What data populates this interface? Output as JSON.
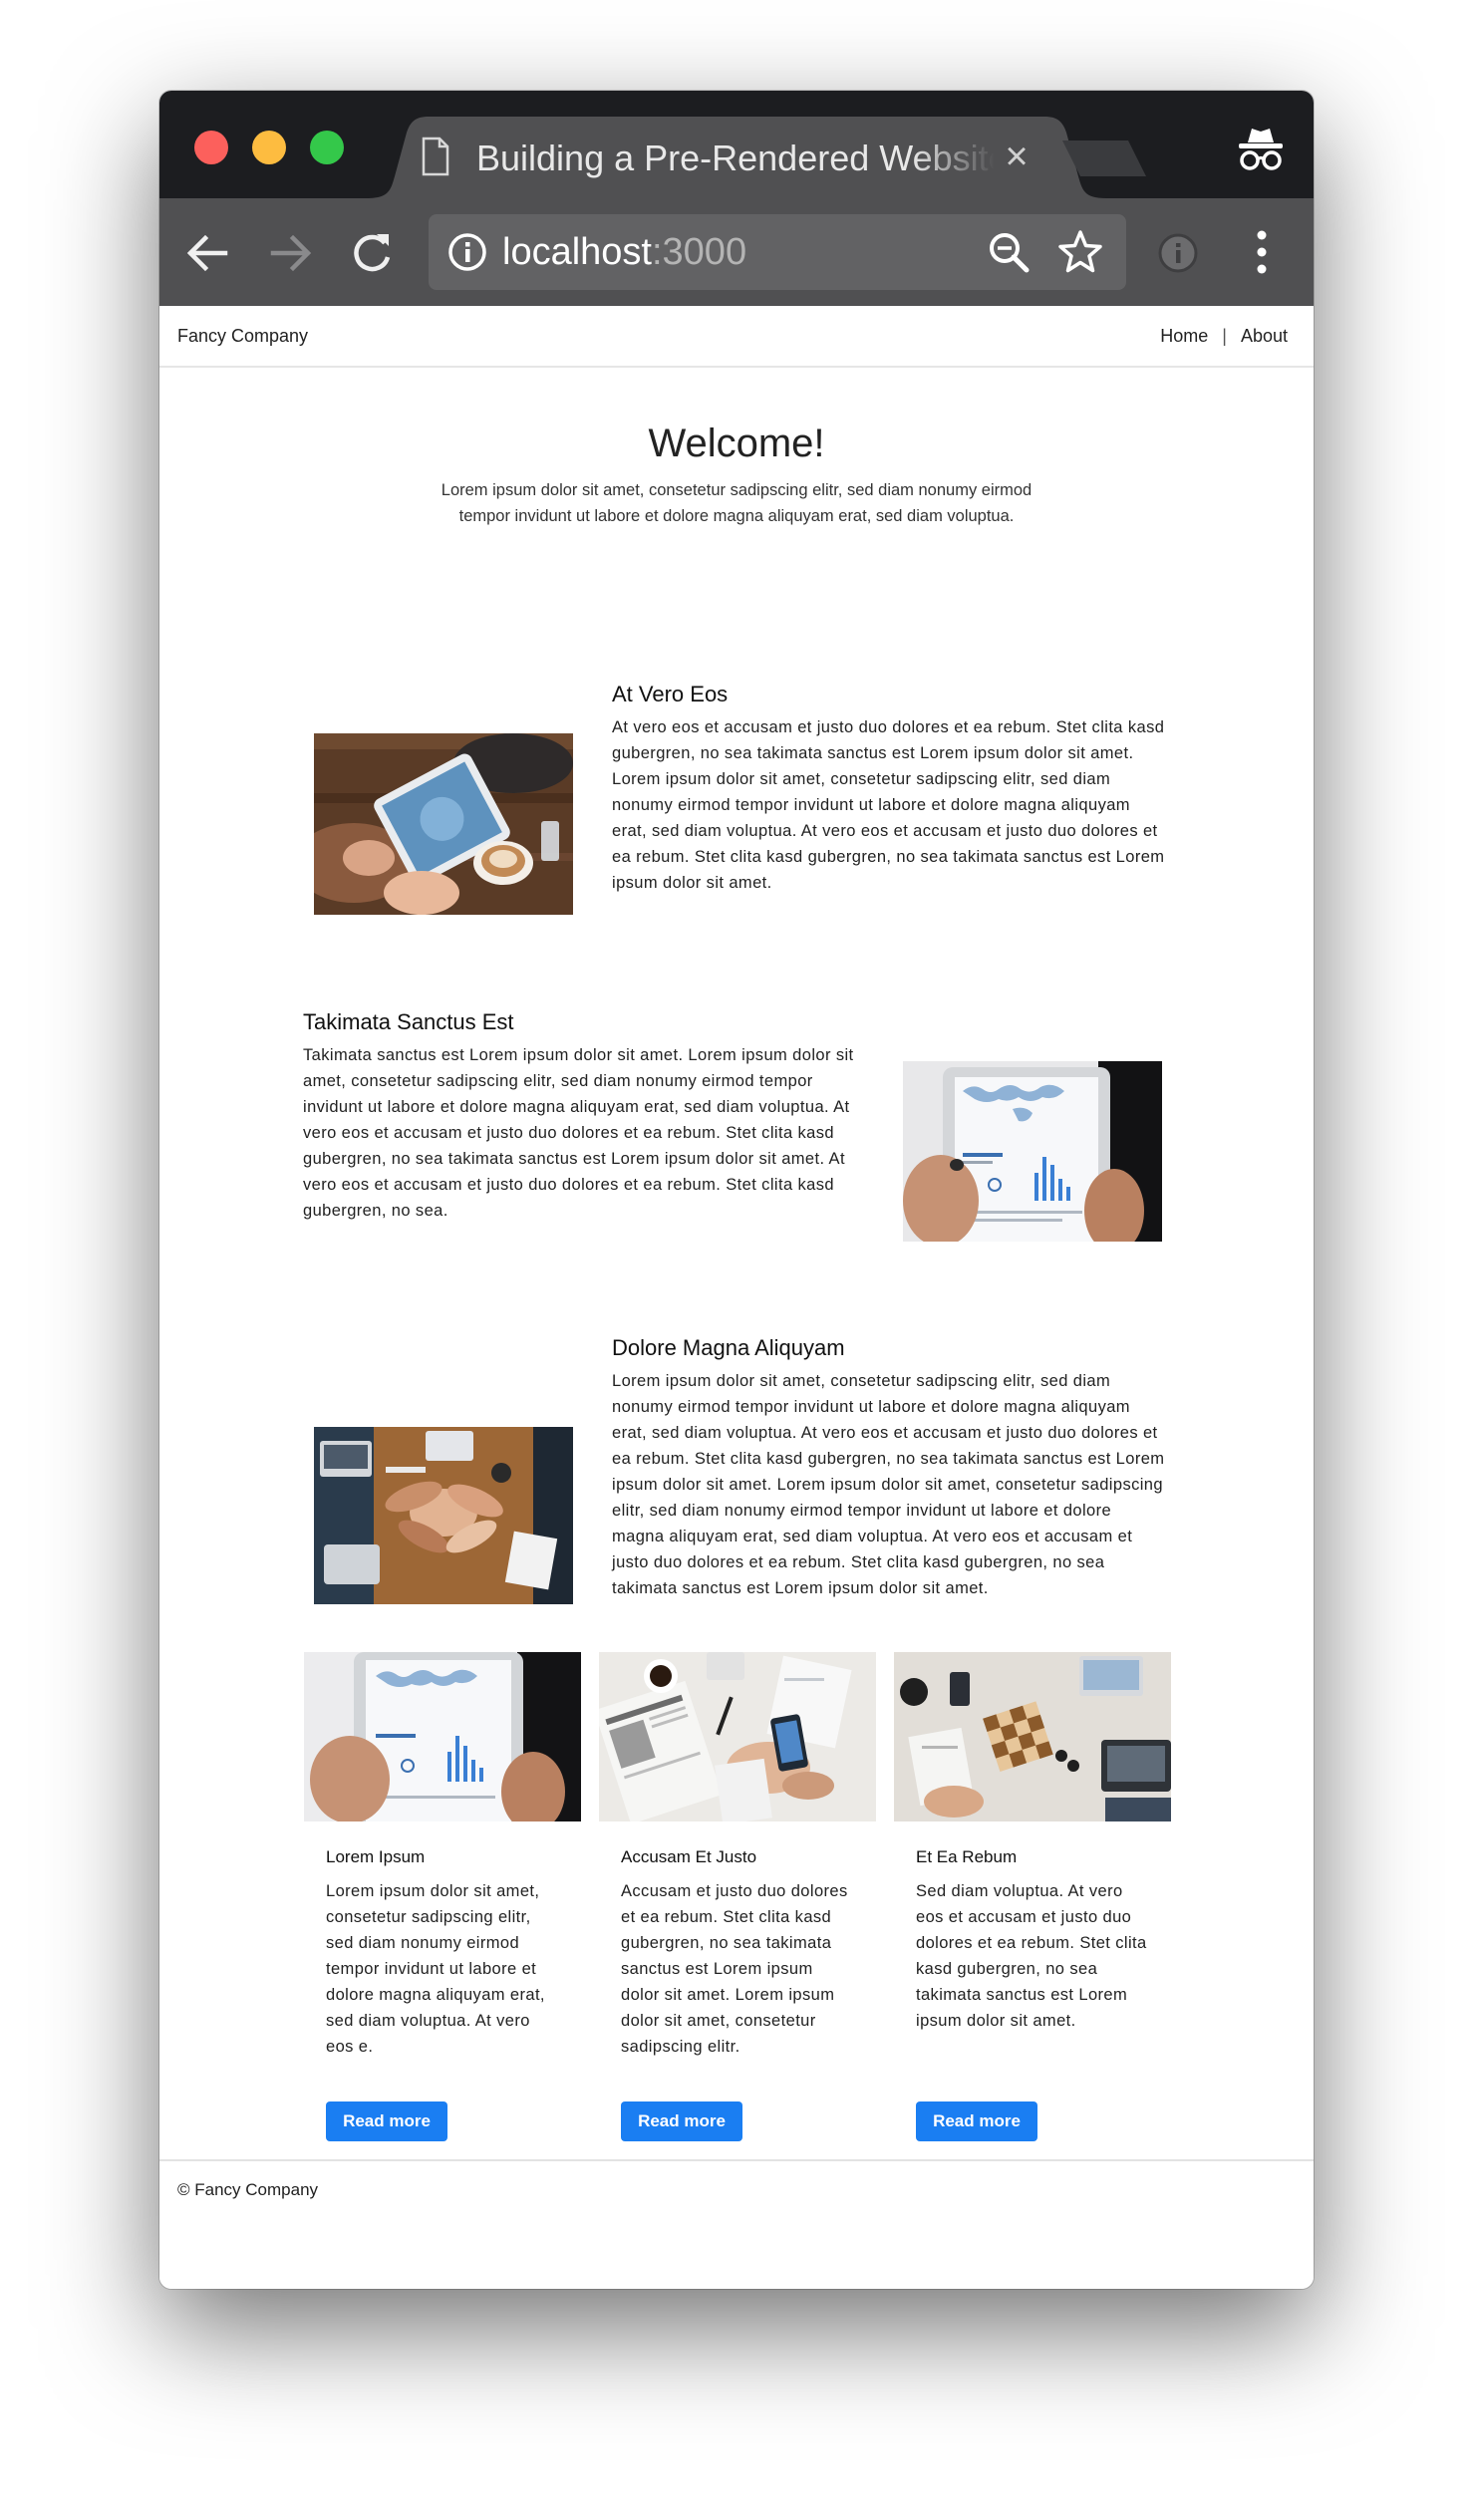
{
  "browser": {
    "tab_title": "Building a Pre-Rendered Website",
    "tab_close": "×",
    "url_host": "localhost",
    "url_port": ":3000"
  },
  "site": {
    "brand": "Fancy Company",
    "nav": [
      "Home",
      "About"
    ],
    "nav_separator": "|",
    "welcome": "Welcome!",
    "intro": "Lorem ipsum dolor sit amet, consetetur sadipscing elitr, sed diam nonumy eirmod tempor invidunt ut labore et dolore magna aliquyam erat, sed diam voluptua.",
    "features": [
      {
        "title": "At Vero Eos",
        "text": "At vero eos et accusam et justo duo dolores et ea rebum. Stet clita kasd gubergren, no sea takimata sanctus est Lorem ipsum dolor sit amet. Lorem ipsum dolor sit amet, consetetur sadipscing elitr, sed diam nonumy eirmod tempor invidunt ut labore et dolore magna aliquyam erat, sed diam voluptua. At vero eos et accusam et justo duo dolores et ea rebum. Stet clita kasd gubergren, no sea takimata sanctus est Lorem ipsum dolor sit amet."
      },
      {
        "title": "Takimata Sanctus Est",
        "text": "Takimata sanctus est Lorem ipsum dolor sit amet. Lorem ipsum dolor sit amet, consetetur sadipscing elitr, sed diam nonumy eirmod tempor invidunt ut labore et dolore magna aliquyam erat, sed diam voluptua. At vero eos et accusam et justo duo dolores et ea rebum. Stet clita kasd gubergren, no sea takimata sanctus est Lorem ipsum dolor sit amet. At vero eos et accusam et justo duo dolores et ea rebum. Stet clita kasd gubergren, no sea."
      },
      {
        "title": "Dolore Magna Aliquyam",
        "text": "Lorem ipsum dolor sit amet, consetetur sadipscing elitr, sed diam nonumy eirmod tempor invidunt ut labore et dolore magna aliquyam erat, sed diam voluptua. At vero eos et accusam et justo duo dolores et ea rebum. Stet clita kasd gubergren, no sea takimata sanctus est Lorem ipsum dolor sit amet. Lorem ipsum dolor sit amet, consetetur sadipscing elitr, sed diam nonumy eirmod tempor invidunt ut labore et dolore magna aliquyam erat, sed diam voluptua. At vero eos et accusam et justo duo dolores et ea rebum. Stet clita kasd gubergren, no sea takimata sanctus est Lorem ipsum dolor sit amet."
      }
    ],
    "cards": [
      {
        "title": "Lorem Ipsum",
        "text": "Lorem ipsum dolor sit amet, consetetur sadipscing elitr, sed diam nonumy eirmod tempor invidunt ut labore et dolore magna aliquyam erat, sed diam voluptua. At vero eos e.",
        "button": "Read more"
      },
      {
        "title": "Accusam Et Justo",
        "text": "Accusam et justo duo dolores et ea rebum. Stet clita kasd gubergren, no sea takimata sanctus est Lorem ipsum dolor sit amet. Lorem ipsum dolor sit amet, consetetur sadipscing elitr.",
        "button": "Read more"
      },
      {
        "title": "Et Ea Rebum",
        "text": "Sed diam voluptua. At vero eos et accusam et justo duo dolores et ea rebum. Stet clita kasd gubergren, no sea takimata sanctus est Lorem ipsum dolor sit amet.",
        "button": "Read more"
      }
    ],
    "footer": "© Fancy Company"
  },
  "icons": {
    "tab": "document-icon",
    "incognito": "incognito-icon",
    "back": "back-arrow-icon",
    "forward": "forward-arrow-icon",
    "reload": "reload-icon",
    "info": "info-icon",
    "zoom": "zoom-out-icon",
    "bookmark": "star-icon",
    "extension": "extension-icon",
    "menu": "kebab-menu-icon"
  },
  "colors": {
    "titlebar": "#1c1d20",
    "tab_active": "#505052",
    "toolbar": "#505052",
    "omnibox": "#626264",
    "accent_button": "#1a7ef2",
    "traffic_close": "#fc605c",
    "traffic_minimize": "#fdbc40",
    "traffic_maximize": "#34c84a"
  }
}
